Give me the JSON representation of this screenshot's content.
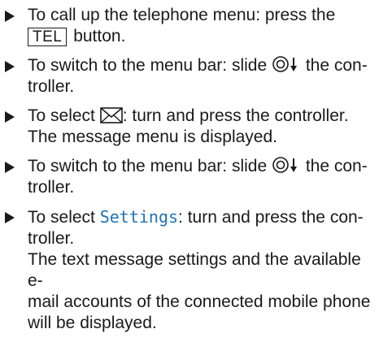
{
  "steps": [
    {
      "before": "To call up the telephone menu: press the",
      "key": "TEL",
      "after": "button."
    },
    {
      "before": "To switch to the menu bar: slide",
      "icon": "controller-slide-down-icon",
      "after": "the con-",
      "line2": "troller."
    },
    {
      "before": "To select",
      "icon": "envelope-icon",
      "after": ": turn and press the controller.",
      "result": "The message menu is displayed."
    },
    {
      "before": "To switch to the menu bar: slide",
      "icon": "controller-slide-down-icon",
      "after": "the con-",
      "line2": "troller."
    },
    {
      "before": "To select",
      "highlight": "Settings",
      "after": ": turn and press the con-",
      "line2": "troller.",
      "result_lines": [
        "The text message settings and the available e-",
        "mail accounts of the connected mobile phone",
        "will be displayed."
      ]
    }
  ],
  "colors": {
    "text": "#1a1a1a",
    "highlight": "#1f73b8"
  }
}
